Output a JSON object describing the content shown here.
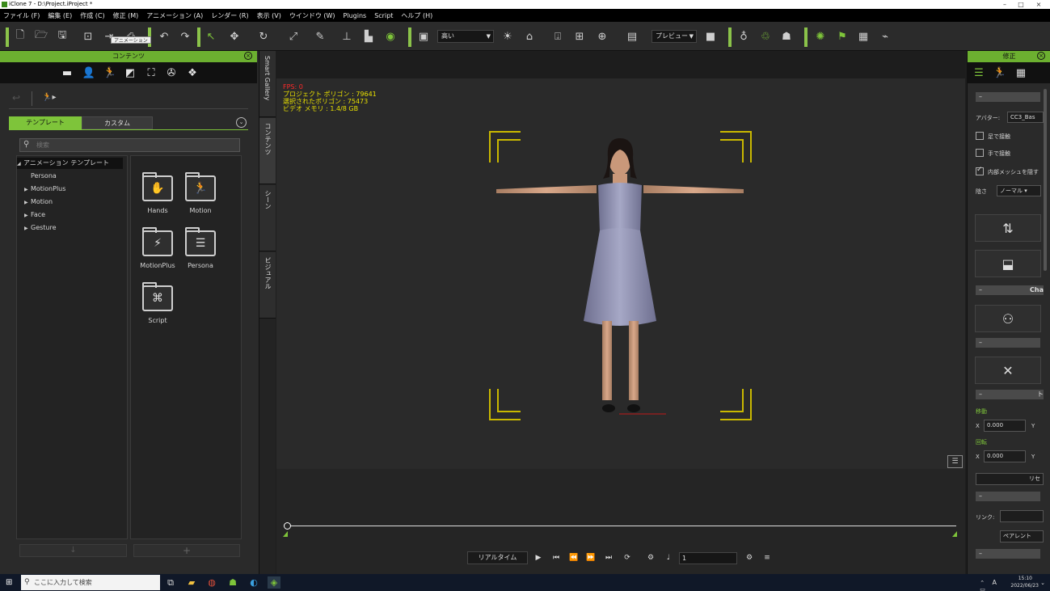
{
  "window": {
    "title": "iClone 7 - D:\\Project.iProject *",
    "controls": [
      "–",
      "□",
      "×"
    ]
  },
  "menubar": [
    "ファイル (F)",
    "編集 (E)",
    "作成 (C)",
    "修正 (M)",
    "アニメーション (A)",
    "レンダー (R)",
    "表示 (V)",
    "ウインドウ (W)",
    "Plugins",
    "Script",
    "ヘルプ (H)"
  ],
  "toolbar": {
    "quality_select": "高い",
    "preview_select": "プレビュー",
    "accent_color": "#7ec43a"
  },
  "content_panel": {
    "title": "コンテンツ",
    "tooltip": "アニメーション",
    "tabs": [
      "テンプレート",
      "カスタム"
    ],
    "search_placeholder": "検索",
    "tree": {
      "root": "アニメーション テンプレート",
      "items": [
        "Persona",
        "MotionPlus",
        "Motion",
        "Face",
        "Gesture"
      ]
    },
    "folders": [
      {
        "label": "Hands",
        "icon": "hands-icon"
      },
      {
        "label": "Motion",
        "icon": "motion-icon"
      },
      {
        "label": "MotionPlus",
        "icon": "motionplus-icon"
      },
      {
        "label": "Persona",
        "icon": "persona-icon"
      },
      {
        "label": "Script",
        "icon": "script-icon"
      }
    ]
  },
  "side_tabs": [
    "Smart Gallery",
    "コンテンツ",
    "シーン",
    "ビジュアル"
  ],
  "viewport": {
    "fps": "FPS: 0",
    "project_polygons": "プロジェクト ポリゴン : 79641",
    "selected_polygons": "選択されたポリゴン : 75473",
    "video_memory": "ビデオ メモリ : 1.4/8 GB"
  },
  "timeline": {
    "realtime_label": "リアルタイム",
    "frame_value": "1"
  },
  "modify_panel": {
    "title": "修正",
    "avatar_label": "アバター:",
    "avatar_value": "CC3_Bas",
    "foot_contact": "足で接触",
    "hand_contact": "手で接触",
    "hide_inner_mesh": "内部メッシュを隠す",
    "shadow_label": "陰さ",
    "shadow_value": "ノーマル",
    "section_cha": "Cha",
    "section_to": "ト",
    "move_label": "移動",
    "rotate_label": "回転",
    "x_label": "X",
    "y_label": "Y",
    "move_x": "0.000",
    "rotate_x": "0.000",
    "reset_label": "リセ",
    "link_label": "リンク:",
    "parent_label": "ペアレント"
  },
  "taskbar": {
    "search_placeholder": "ここに入力して検索",
    "time": "15:10",
    "date": "2022/06/23",
    "ime": "A"
  }
}
